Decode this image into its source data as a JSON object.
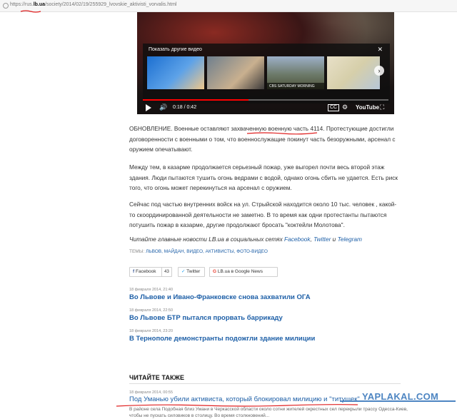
{
  "browser": {
    "url_prefix": "https://rus.",
    "url_domain": "lb.ua",
    "url_path": "/society/2014/02/19/255929_lvovskie_aktivisti_vorvalis.html"
  },
  "video": {
    "more_videos_title": "Показать другие видео",
    "close_symbol": "✕",
    "thumb_caption": "CBS SATURDAY MORNING",
    "time": "0:18 / 0:42",
    "progress_fraction": 0.43,
    "youtube_label": "YouTube",
    "subtitles_label": "CC"
  },
  "article": {
    "p1": "ОБНОВЛЕНИЕ. Военные оставляют захваченную военную часть 4114. Протестующие достигли договоренности с военными о том, что военнослужащие покинут часть безоружными, арсенал с оружием опечатывают.",
    "p2": "Между тем, в казарме продолжается серьезный пожар, уже выгорел почти весь второй этаж здания. Люди пытаются тушить огонь ведрами с водой, однако огонь сбить не удается. Есть риск того, что огонь может перекинуться на арсенал с оружием.",
    "p3": "Сейчас под частью внутренних войск на ул. Стрыйской находится около 10 тыс. человек , какой-то скоординированной деятельности не заметно. В то время как одни протестанты пытаются потушить пожар в казарме, другие продолжают бросать \"коктейли Молотова\".",
    "social_prefix": "Читайте главные новости LB.ua в социальных сетях ",
    "social_facebook": "Facebook",
    "social_sep1": ", ",
    "social_twitter": "Twitter",
    "social_and": " и ",
    "social_telegram": "Telegram",
    "tags_label": "ТЕМЫ: ",
    "tags": "ЛЬВОВ, МАЙДАН, ВИДЕО, АКТИВИСТЫ, ФОТО-ВИДЕО"
  },
  "share": {
    "facebook_mark": "f",
    "facebook_label": "Facebook",
    "facebook_count": "43",
    "twitter_mark": "✓",
    "twitter_label": "Twitter",
    "gnews_mark": "G",
    "gnews_label": "LB.ua в Google News"
  },
  "news": [
    {
      "date": "18 февраля 2014, 21:40",
      "title": "Во Львове и Ивано-Франковске снова захватили ОГА"
    },
    {
      "date": "18 февраля 2014, 22:50",
      "title": "Во Львове БТР пытался прорвать баррикаду"
    },
    {
      "date": "18 февраля 2014, 23:20",
      "title": "В Тернополе демонстранты подожгли здание милиции"
    }
  ],
  "read_also": {
    "heading": "ЧИТАЙТЕ ТАКЖЕ",
    "date": "18 февраля 2014, 00:55",
    "title": "Под Уманью убили активиста, который блокировал милицию и \"титушек\"",
    "desc": "В районе села Подобная близ Умани в Черкасской области около сотни жителей окрестных сел перекрыли трассу Одесса-Киев, чтобы не пускать силовиков в столицу. Во время столкновений..."
  },
  "watermark": "YAPLAKAL.COM",
  "colors": {
    "link": "#1d5fa7",
    "annotation_red": "#e02020",
    "watermark": "#4d85c2"
  }
}
